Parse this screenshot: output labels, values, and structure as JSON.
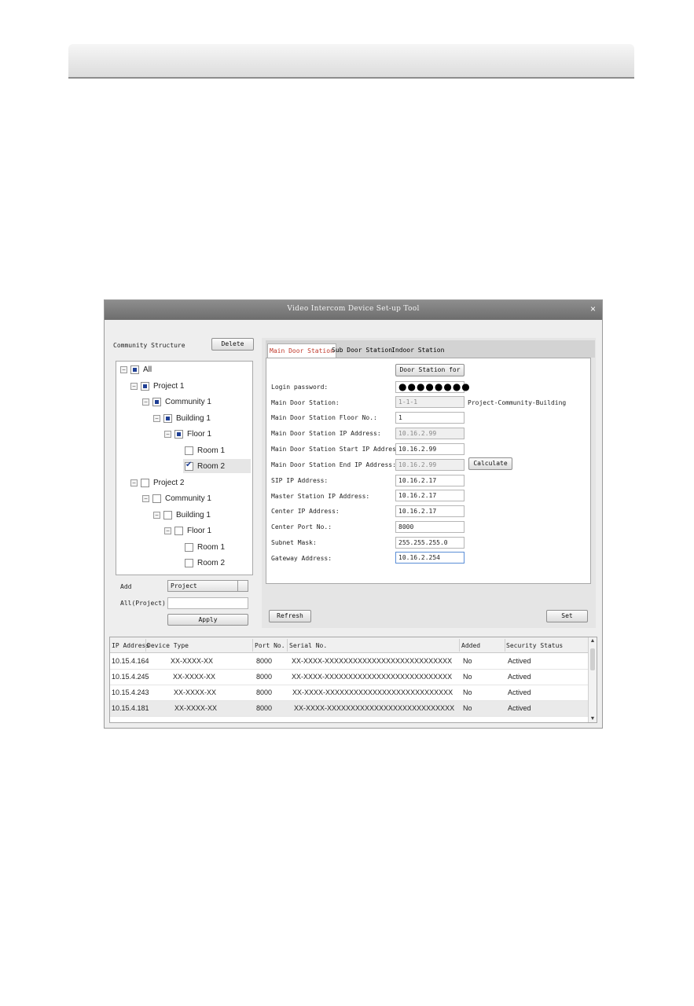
{
  "window": {
    "title": "Video Intercom Device Set-up Tool",
    "close_symbol": "×"
  },
  "left": {
    "header_label": "Community Structure",
    "delete_label": "Delete",
    "tree": [
      {
        "label": "All",
        "state": "partial"
      },
      {
        "label": "Project 1",
        "state": "partial"
      },
      {
        "label": "Community 1",
        "state": "partial"
      },
      {
        "label": "Building 1",
        "state": "partial"
      },
      {
        "label": "Floor 1",
        "state": "partial"
      },
      {
        "label": "Room 1",
        "state": "unchecked"
      },
      {
        "label": "Room 2",
        "state": "checked"
      },
      {
        "label": "Project 2",
        "state": "unchecked"
      },
      {
        "label": "Community 1",
        "state": "unchecked"
      },
      {
        "label": "Building 1",
        "state": "unchecked"
      },
      {
        "label": "Floor 1",
        "state": "unchecked"
      },
      {
        "label": "Room 1",
        "state": "unchecked"
      },
      {
        "label": "Room 2",
        "state": "unchecked"
      }
    ],
    "add_label": "Add",
    "add_select_value": "Project",
    "all_label": "All(Project)",
    "all_value": "",
    "apply_label": "Apply"
  },
  "tabs": [
    "Main Door Station",
    "Sub Door Station",
    "Indoor Station"
  ],
  "form": {
    "door_station_button": "Door Station for",
    "login_password_label": "Login password:",
    "login_password_value": "●●●●●●●●",
    "main_door_station_label": "Main Door Station:",
    "main_door_station_value": "1-1-1",
    "main_door_station_hint": "Project-Community-Building",
    "floor_no_label": "Main Door Station Floor No.:",
    "floor_no_value": "1",
    "ip_label": "Main Door Station IP Address:",
    "ip_value": "10.16.2.99",
    "start_ip_label": "Main Door Station Start IP Address:",
    "start_ip_value": "10.16.2.99",
    "end_ip_label": "Main Door Station End IP Address:",
    "end_ip_value": "10.16.2.99",
    "calculate_label": "Calculate",
    "sip_label": "SIP IP Address:",
    "sip_value": "10.16.2.17",
    "master_label": "Master Station IP Address:",
    "master_value": "10.16.2.17",
    "center_ip_label": "Center IP Address:",
    "center_ip_value": "10.16.2.17",
    "center_port_label": "Center Port No.:",
    "center_port_value": "8000",
    "subnet_label": "Subnet Mask:",
    "subnet_value": "255.255.255.0",
    "gateway_label": "Gateway Address:",
    "gateway_value": "10.16.2.254",
    "refresh_label": "Refresh",
    "set_label": "Set"
  },
  "table": {
    "columns": [
      "IP Address",
      "Device Type",
      "Port No.",
      "Serial No.",
      "Added",
      "Security Status"
    ],
    "rows": [
      [
        "10.15.4.164",
        "XX-XXXX-XX",
        "8000",
        "XX-XXXX-XXXXXXXXXXXXXXXXXXXXXXXXXXX",
        "No",
        "Actived"
      ],
      [
        "10.15.4.245",
        "XX-XXXX-XX",
        "8000",
        "XX-XXXX-XXXXXXXXXXXXXXXXXXXXXXXXXXX",
        "No",
        "Actived"
      ],
      [
        "10.15.4.243",
        "XX-XXXX-XX",
        "8000",
        "XX-XXXX-XXXXXXXXXXXXXXXXXXXXXXXXXXX",
        "No",
        "Actived"
      ],
      [
        "10.15.4.181",
        "XX-XXXX-XX",
        "8000",
        "XX-XXXX-XXXXXXXXXXXXXXXXXXXXXXXXXXX",
        "No",
        "Actived"
      ]
    ]
  },
  "colors": {
    "active_tab_text": "#c0392b",
    "checkbox_accent": "#1f3f95",
    "titlebar": "#7a7a7a"
  }
}
